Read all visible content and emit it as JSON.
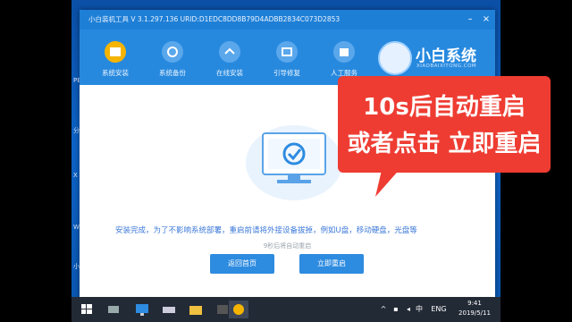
{
  "window": {
    "title": "小白装机工具 V 3.1.297.136 URID:D1EDC8DD8B79D4ADBB2834C073D2853"
  },
  "tabs": [
    {
      "label": "系统安装",
      "active": true
    },
    {
      "label": "系统备份",
      "active": false
    },
    {
      "label": "在线安装",
      "active": false
    },
    {
      "label": "引导修复",
      "active": false
    },
    {
      "label": "人工服务",
      "active": false
    }
  ],
  "brand": {
    "name": "小白系统",
    "sub": "XIAOBAIXITONG.COM"
  },
  "content": {
    "message": "安装完成，为了不影响系统部署，重启前请将外接设备拔掉，例如U盘，移动硬盘，光盘等",
    "countdown": "9秒后将自动重启",
    "back_button": "返回首页",
    "restart_button": "立即重启"
  },
  "callout": {
    "line1": "10s后自动重启",
    "line2": "或者点击 立即重启",
    "color": "#ee3c32"
  },
  "taskbar": {
    "time": "9:41",
    "date": "2019/5/11",
    "ime": "中",
    "lang": "ENG"
  },
  "colors": {
    "accent": "#2d8be0",
    "header": "#2789de",
    "titlebar": "#1e7fd6"
  }
}
